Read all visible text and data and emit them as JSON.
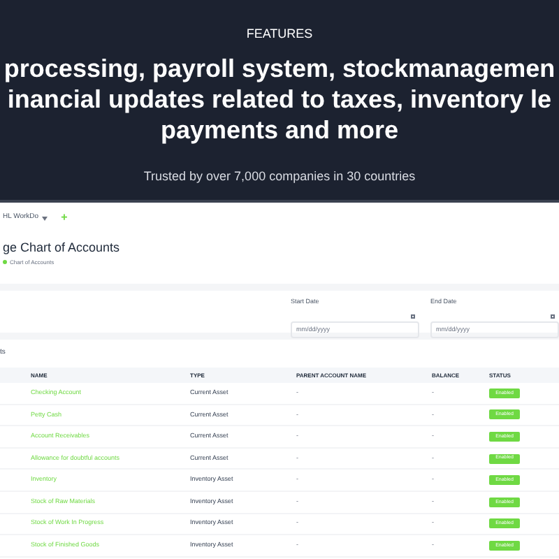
{
  "hero": {
    "eyebrow": "FEATURES",
    "headline_lines": [
      "processing, payroll system, stockmanagemen",
      "inancial updates related to taxes, inventory le",
      "payments and more"
    ],
    "tagline": "Trusted by over 7,000 companies in 30 countries"
  },
  "app": {
    "workspace": "HL WorkDo",
    "add": "+",
    "title": "ge Chart of Accounts",
    "breadcrumb": [
      "Chart of Accounts"
    ],
    "filters": [
      {
        "label": "Start Date",
        "placeholder": "mm/dd/yyyy"
      },
      {
        "label": "End Date",
        "placeholder": "mm/dd/yyyy"
      }
    ],
    "section_label": "ts",
    "table": {
      "columns": [
        "NAME",
        "TYPE",
        "PARENT ACCOUNT NAME",
        "BALANCE",
        "STATUS"
      ],
      "rows": [
        {
          "name": "Checking Account",
          "type": "Current Asset",
          "parent": "-",
          "balance": "-",
          "status": "Enabled",
          "enabled": true
        },
        {
          "name": "Petty Cash",
          "type": "Current Asset",
          "parent": "-",
          "balance": "-",
          "status": "Enabled",
          "enabled": true
        },
        {
          "name": "Account Receivables",
          "type": "Current Asset",
          "parent": "-",
          "balance": "-",
          "status": "Enabled",
          "enabled": true
        },
        {
          "name": "Allowance for doubtful accounts",
          "type": "Current Asset",
          "parent": "-",
          "balance": "-",
          "status": "Enabled",
          "enabled": true
        },
        {
          "name": "Inventory",
          "type": "Inventory Asset",
          "parent": "-",
          "balance": "-",
          "status": "Enabled",
          "enabled": true
        },
        {
          "name": "Stock of Raw Materials",
          "type": "Inventory Asset",
          "parent": "-",
          "balance": "-",
          "status": "Enabled",
          "enabled": true
        },
        {
          "name": "Stock of Work In Progress",
          "type": "Inventory Asset",
          "parent": "-",
          "balance": "-",
          "status": "Enabled",
          "enabled": true
        },
        {
          "name": "Stock of Finished Goods",
          "type": "Inventory Asset",
          "parent": "-",
          "balance": "-",
          "status": "Enabled",
          "enabled": true
        }
      ]
    }
  }
}
